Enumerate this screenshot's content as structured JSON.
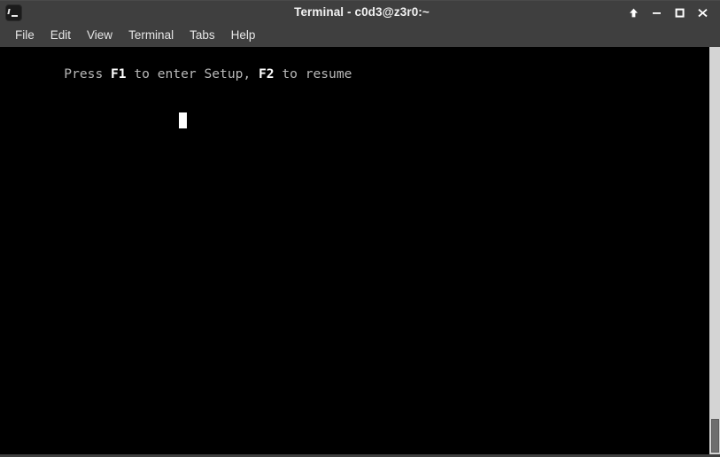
{
  "window": {
    "title": "Terminal - c0d3@z3r0:~",
    "icon": "terminal-icon",
    "controls": [
      {
        "name": "shade-button",
        "glyph": "up-arrow-icon",
        "label": "Shade"
      },
      {
        "name": "minimize-button",
        "glyph": "minimize-icon",
        "label": "Minimize"
      },
      {
        "name": "maximize-button",
        "glyph": "maximize-icon",
        "label": "Maximize"
      },
      {
        "name": "close-button",
        "glyph": "close-icon",
        "label": "Close"
      }
    ]
  },
  "menubar": {
    "items": [
      {
        "label": "File"
      },
      {
        "label": "Edit"
      },
      {
        "label": "View"
      },
      {
        "label": "Terminal"
      },
      {
        "label": "Tabs"
      },
      {
        "label": "Help"
      }
    ]
  },
  "terminal": {
    "lines": [
      {
        "segments": [
          {
            "text": "Press ",
            "style": "normal"
          },
          {
            "text": "F1",
            "style": "bold"
          },
          {
            "text": " to enter Setup, ",
            "style": "normal"
          },
          {
            "text": "F2",
            "style": "bold"
          },
          {
            "text": " to resume",
            "style": "normal"
          }
        ]
      }
    ],
    "plain_text": "Press F1 to enter Setup, F2 to resume",
    "cursor": {
      "row": 2,
      "column": 21,
      "shape": "block"
    },
    "colors": {
      "background": "#000000",
      "foreground": "#b8b8b8",
      "bold_foreground": "#ffffff",
      "cursor": "#ffffff"
    }
  },
  "scrollbar": {
    "name": "vertical-scrollbar",
    "track_color": "#d4d4d4",
    "thumb_color": "#6e6e6e",
    "thumb_position_percent": 92
  },
  "theme": {
    "titlebar_bg": "#3f3f3f",
    "menubar_bg": "#3f3f3f",
    "title_fg": "#f2f2f2",
    "menu_fg": "#e6e6e6"
  }
}
